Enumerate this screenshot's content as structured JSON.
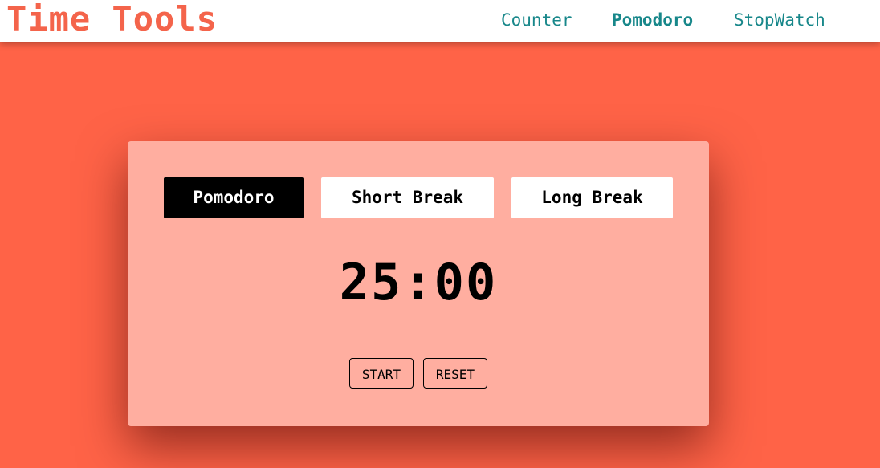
{
  "header": {
    "logo": "Time Tools",
    "nav": [
      {
        "label": "Counter",
        "active": false
      },
      {
        "label": "Pomodoro",
        "active": true
      },
      {
        "label": "StopWatch",
        "active": false
      }
    ]
  },
  "timer": {
    "modes": [
      {
        "label": "Pomodoro",
        "selected": true
      },
      {
        "label": "Short Break",
        "selected": false
      },
      {
        "label": "Long Break",
        "selected": false
      }
    ],
    "time": "25:00",
    "start_label": "START",
    "reset_label": "RESET"
  },
  "colors": {
    "background": "#ff6347",
    "card": "#ffaea0",
    "logo": "#f4644b",
    "nav": "#17878a",
    "active_mode": "#000000"
  }
}
